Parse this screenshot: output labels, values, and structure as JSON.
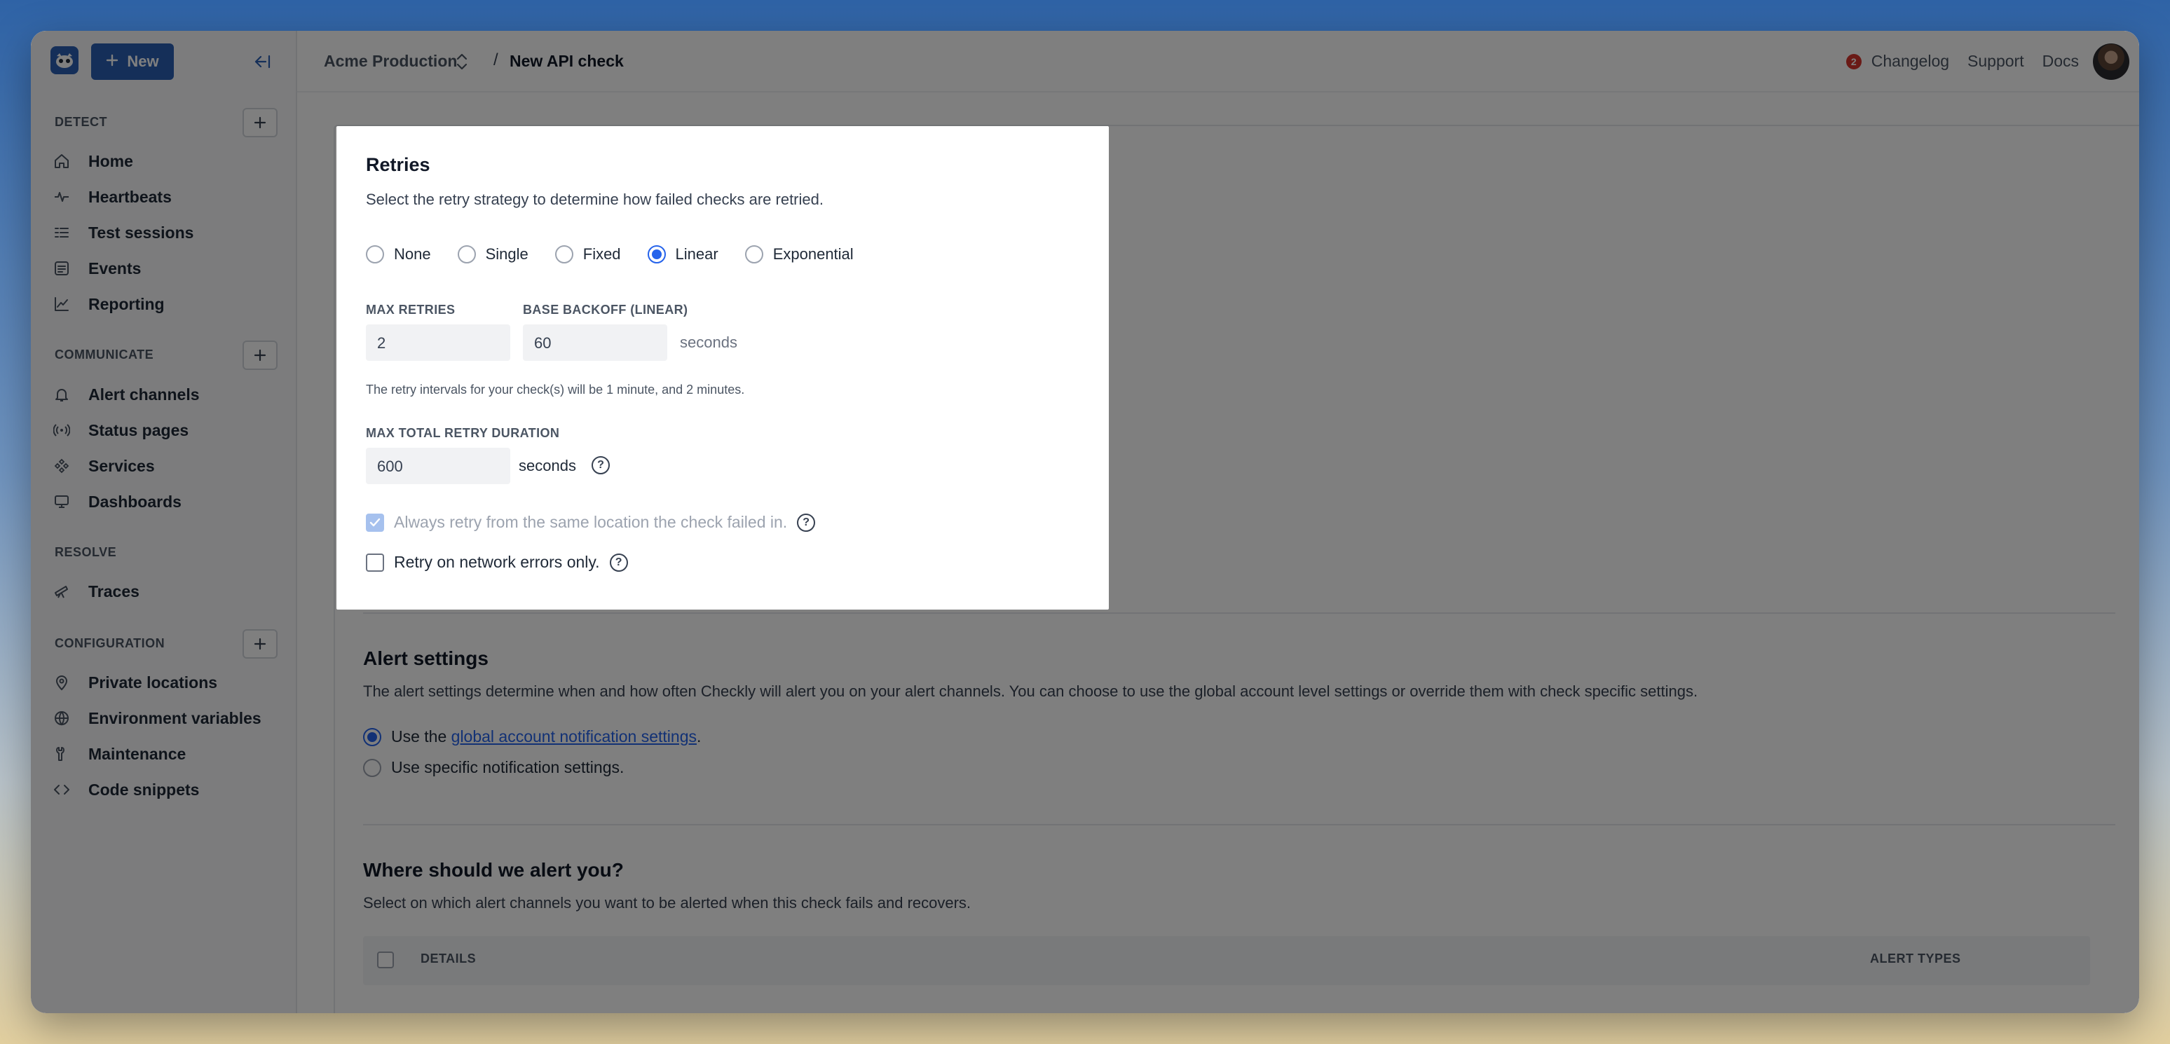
{
  "sidebar": {
    "new_label": "New",
    "sections": {
      "detect": "DETECT",
      "communicate": "COMMUNICATE",
      "resolve": "RESOLVE",
      "configuration": "CONFIGURATION"
    },
    "items": [
      {
        "label": "Home",
        "icon": "home-icon"
      },
      {
        "label": "Heartbeats",
        "icon": "heartbeat-icon"
      },
      {
        "label": "Test sessions",
        "icon": "list-check-icon"
      },
      {
        "label": "Events",
        "icon": "events-icon"
      },
      {
        "label": "Reporting",
        "icon": "chart-line-icon"
      },
      {
        "label": "Alert channels",
        "icon": "bell-icon"
      },
      {
        "label": "Status pages",
        "icon": "broadcast-icon"
      },
      {
        "label": "Services",
        "icon": "services-icon"
      },
      {
        "label": "Dashboards",
        "icon": "monitor-icon"
      },
      {
        "label": "Traces",
        "icon": "telescope-icon"
      },
      {
        "label": "Private locations",
        "icon": "location-pin-icon"
      },
      {
        "label": "Environment variables",
        "icon": "globe-icon"
      },
      {
        "label": "Maintenance",
        "icon": "maintenance-icon"
      },
      {
        "label": "Code snippets",
        "icon": "code-icon"
      }
    ]
  },
  "topbar": {
    "org": "Acme Production",
    "separator": "/",
    "page": "New API check",
    "changelog_count": "2",
    "changelog": "Changelog",
    "support": "Support",
    "docs": "Docs"
  },
  "main": {
    "alert_settings": {
      "title": "Alert settings",
      "description": "The alert settings determine when and how often Checkly will alert you on your alert channels. You can choose to use the global account level settings or override them with check specific settings.",
      "option1_prefix": "Use the ",
      "option1_link": "global account notification settings",
      "option1_suffix": ".",
      "option2": "Use specific notification settings."
    },
    "where_alert": {
      "title": "Where should we alert you?",
      "description": "Select on which alert channels you want to be alerted when this check fails and recovers.",
      "col_details": "DETAILS",
      "col_alert_types": "ALERT TYPES"
    }
  },
  "modal": {
    "title": "Retries",
    "description": "Select the retry strategy to determine how failed checks are retried.",
    "strategies": [
      {
        "label": "None",
        "selected": false
      },
      {
        "label": "Single",
        "selected": false
      },
      {
        "label": "Fixed",
        "selected": false
      },
      {
        "label": "Linear",
        "selected": true
      },
      {
        "label": "Exponential",
        "selected": false
      }
    ],
    "max_retries_label": "MAX RETRIES",
    "max_retries_value": "2",
    "base_backoff_label": "BASE BACKOFF (LINEAR)",
    "base_backoff_value": "60",
    "base_backoff_unit": "seconds",
    "intervals_hint": "The retry intervals for your check(s) will be 1 minute, and 2 minutes.",
    "max_duration_label": "MAX TOTAL RETRY DURATION",
    "max_duration_value": "600",
    "max_duration_unit": "seconds",
    "same_location_label": "Always retry from the same location the check failed in.",
    "network_only_label": "Retry on network errors only."
  },
  "colors": {
    "accent": "#2a5fb3",
    "radio_selected": "#2563eb",
    "badge": "#d4342c"
  }
}
